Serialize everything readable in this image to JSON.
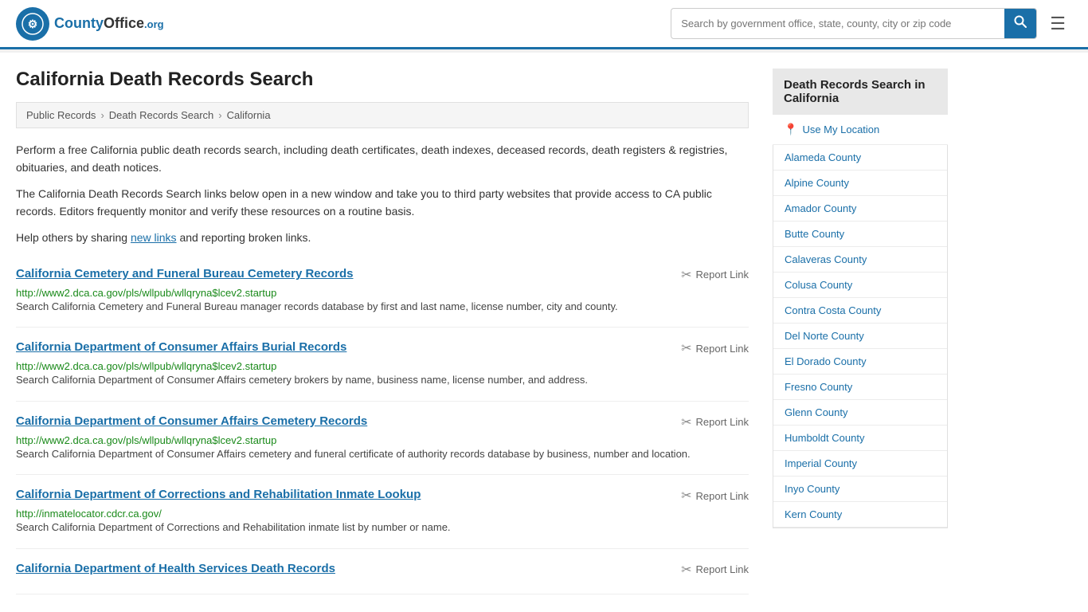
{
  "header": {
    "logo_text": "CountyOffice",
    "logo_org": ".org",
    "search_placeholder": "Search by government office, state, county, city or zip code",
    "menu_icon": "☰"
  },
  "breadcrumb": {
    "items": [
      "Public Records",
      "Death Records Search",
      "California"
    ]
  },
  "page": {
    "title": "California Death Records Search",
    "intro1": "Perform a free California public death records search, including death certificates, death indexes, deceased records, death registers & registries, obituaries, and death notices.",
    "intro2": "The California Death Records Search links below open in a new window and take you to third party websites that provide access to CA public records. Editors frequently monitor and verify these resources on a routine basis.",
    "intro3_prefix": "Help others by sharing ",
    "intro3_link": "new links",
    "intro3_suffix": " and reporting broken links."
  },
  "results": [
    {
      "title": "California Cemetery and Funeral Bureau Cemetery Records",
      "url": "http://www2.dca.ca.gov/pls/wllpub/wllqryna$lcev2.startup",
      "desc": "Search California Cemetery and Funeral Bureau manager records database by first and last name, license number, city and county.",
      "report": "Report Link"
    },
    {
      "title": "California Department of Consumer Affairs Burial Records",
      "url": "http://www2.dca.ca.gov/pls/wllpub/wllqryna$lcev2.startup",
      "desc": "Search California Department of Consumer Affairs cemetery brokers by name, business name, license number, and address.",
      "report": "Report Link"
    },
    {
      "title": "California Department of Consumer Affairs Cemetery Records",
      "url": "http://www2.dca.ca.gov/pls/wllpub/wllqryna$lcev2.startup",
      "desc": "Search California Department of Consumer Affairs cemetery and funeral certificate of authority records database by business, number and location.",
      "report": "Report Link"
    },
    {
      "title": "California Department of Corrections and Rehabilitation Inmate Lookup",
      "url": "http://inmatelocator.cdcr.ca.gov/",
      "desc": "Search California Department of Corrections and Rehabilitation inmate list by number or name.",
      "report": "Report Link"
    },
    {
      "title": "California Department of Health Services Death Records",
      "url": "",
      "desc": "",
      "report": "Report Link"
    }
  ],
  "sidebar": {
    "title": "Death Records Search in California",
    "use_my_location": "Use My Location",
    "counties": [
      "Alameda County",
      "Alpine County",
      "Amador County",
      "Butte County",
      "Calaveras County",
      "Colusa County",
      "Contra Costa County",
      "Del Norte County",
      "El Dorado County",
      "Fresno County",
      "Glenn County",
      "Humboldt County",
      "Imperial County",
      "Inyo County",
      "Kern County"
    ]
  }
}
